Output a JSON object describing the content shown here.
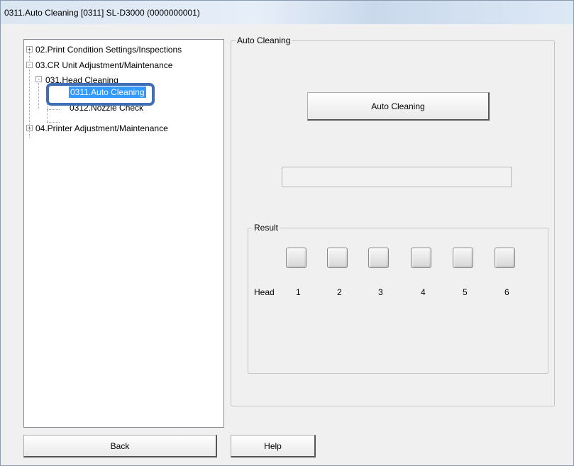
{
  "window": {
    "title": "0311.Auto Cleaning  [0311]  SL-D3000  (0000000001)"
  },
  "tree": {
    "items": [
      {
        "label": "02.Print Condition Settings/Inspections",
        "expander": "+"
      },
      {
        "label": "03.CR Unit Adjustment/Maintenance",
        "expander": "-"
      },
      {
        "label": "031.Head Cleaning",
        "expander": "-"
      },
      {
        "label": "0311.Auto Cleaning",
        "selected": true
      },
      {
        "label": "0312.Nozzle Check"
      },
      {
        "label": "04.Printer Adjustment/Maintenance",
        "expander": "+"
      }
    ]
  },
  "auto_cleaning_group": {
    "label": "Auto Cleaning",
    "button_label": "Auto Cleaning",
    "status_text": ""
  },
  "result_group": {
    "label": "Result",
    "head_label": "Head",
    "heads": [
      "1",
      "2",
      "3",
      "4",
      "5",
      "6"
    ]
  },
  "footer": {
    "back_label": "Back",
    "help_label": "Help"
  },
  "colors": {
    "selection": "#3399ff",
    "callout": "#3f6fb4"
  }
}
